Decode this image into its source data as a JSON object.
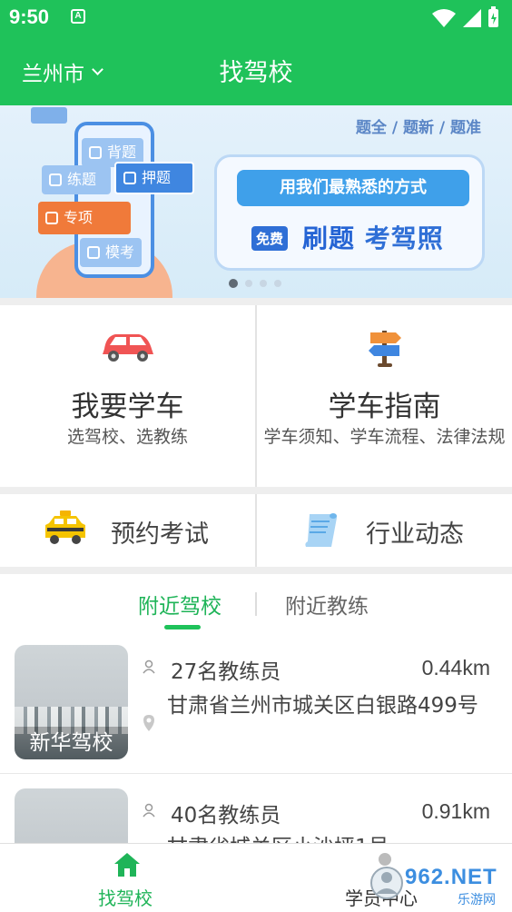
{
  "status_bar": {
    "time": "9:50",
    "notification_glyph": "A",
    "icons": [
      "wifi-icon",
      "signal-icon",
      "battery-icon"
    ]
  },
  "header": {
    "city": "兰州市",
    "title": "找驾校"
  },
  "banner": {
    "tagline": "题全 / 题新 / 题准",
    "chips": [
      "背题",
      "练题",
      "押题",
      "专项",
      "模考"
    ],
    "slogan": "用我们最熟悉的方式",
    "free_badge": "免费",
    "headline_a": "刷题",
    "headline_b": "考驾照",
    "page_count": 4,
    "active_page": 1
  },
  "features": [
    {
      "title": "我要学车",
      "subtitle": "选驾校、选教练",
      "icon": "car-icon"
    },
    {
      "title": "学车指南",
      "subtitle": "学车须知、学车流程、法律法规",
      "icon": "signpost-icon"
    }
  ],
  "quick_links": [
    {
      "label": "预约考试",
      "icon": "taxi-icon"
    },
    {
      "label": "行业动态",
      "icon": "scroll-icon"
    }
  ],
  "tabs": [
    {
      "label": "附近驾校",
      "active": true
    },
    {
      "label": "附近教练",
      "active": false
    }
  ],
  "schools": [
    {
      "name": "新华驾校",
      "coaches": "27名教练员",
      "distance": "0.44km",
      "address": "甘肃省兰州市城关区白银路499号"
    },
    {
      "name": "",
      "coaches": "40名教练员",
      "distance": "0.91km",
      "address": "甘肃省城关区小沙坪1号"
    }
  ],
  "bottom_nav": [
    {
      "label": "找驾校",
      "icon": "home-icon",
      "active": true
    },
    {
      "label": "学员中心",
      "icon": "user-icon",
      "active": false
    }
  ],
  "watermark": {
    "text": "962.NET",
    "sub": "乐游网"
  },
  "colors": {
    "brand_green": "#1fc25a",
    "active_tab": "#1fb458",
    "banner_blue": "#3fa0ea",
    "headline_blue": "#2564d4"
  }
}
